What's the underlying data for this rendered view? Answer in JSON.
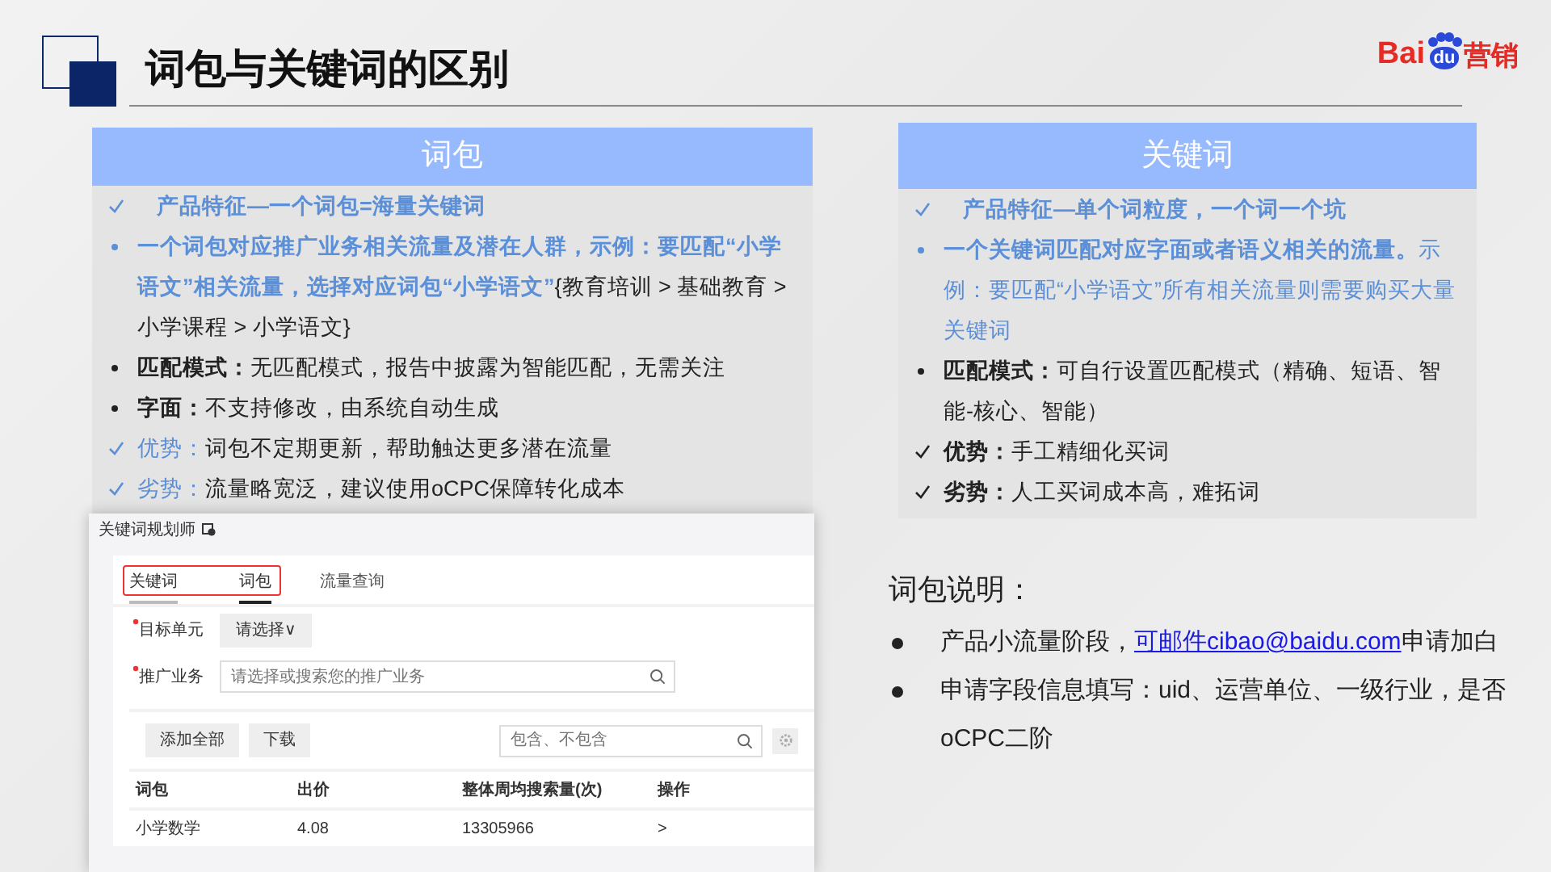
{
  "slide": {
    "title": "词包与关键词的区别"
  },
  "logo": {
    "brand": "Bai",
    "paw_text": "du",
    "suffix": "营销"
  },
  "panels": [
    {
      "header": "词包",
      "items": [
        {
          "kind": "check",
          "accent": true,
          "indent": true,
          "parts": [
            {
              "text": "**产品特征—一个词包=海量关键词**",
              "accent": true
            }
          ]
        },
        {
          "kind": "dot",
          "accent": true,
          "indent": false,
          "parts": [
            {
              "text": "**一个词包对应推广业务相关流量及潜在人群，示例：要匹配“小学语文”相关流量，选择对应词包“小学语文”**",
              "accent": true
            },
            {
              "text": "{教育培训 > 基础教育 > 小学课程 > 小学语文}",
              "accent": false
            }
          ]
        },
        {
          "kind": "dot",
          "accent": false,
          "indent": false,
          "parts": [
            {
              "text": "**匹配模式：**无匹配模式，报告中披露为智能匹配，无需关注",
              "accent": false
            }
          ]
        },
        {
          "kind": "dot",
          "accent": false,
          "indent": false,
          "parts": [
            {
              "text": "**字面：**不支持修改，由系统自动生成",
              "accent": false
            }
          ]
        },
        {
          "kind": "check",
          "accent": true,
          "indent": false,
          "parts": [
            {
              "text": "优势：",
              "accent": true
            },
            {
              "text": "词包不定期更新，帮助触达更多潜在流量",
              "accent": false
            }
          ]
        },
        {
          "kind": "check",
          "accent": true,
          "indent": false,
          "parts": [
            {
              "text": "劣势：",
              "accent": true
            },
            {
              "text": "流量略宽泛，建议使用oCPC保障转化成本",
              "accent": false
            }
          ]
        }
      ]
    },
    {
      "header": "关键词",
      "items": [
        {
          "kind": "check",
          "accent": true,
          "indent": true,
          "parts": [
            {
              "text": "**产品特征—单个词粒度，一个词一个坑**",
              "accent": true
            }
          ]
        },
        {
          "kind": "dot",
          "accent": true,
          "indent": false,
          "parts": [
            {
              "text": "**一个关键词匹配对应字面或者语义相关的流量。**示例：要匹配“小学语文”所有相关流量则需要购买大量关键词",
              "accent": true
            }
          ]
        },
        {
          "kind": "dot",
          "accent": false,
          "indent": false,
          "parts": [
            {
              "text": "**匹配模式：**可自行设置匹配模式（精确、短语、智能-核心、智能）",
              "accent": false
            }
          ]
        },
        {
          "kind": "check",
          "accent": false,
          "indent": false,
          "parts": [
            {
              "text": "**优势：**手工精细化买词",
              "accent": false
            }
          ]
        },
        {
          "kind": "check",
          "accent": false,
          "indent": false,
          "parts": [
            {
              "text": "**劣势：**人工买词成本高，难拓词",
              "accent": false
            }
          ]
        }
      ]
    }
  ],
  "screenshot": {
    "title": "关键词规划师",
    "tabs": [
      {
        "label": "关键词",
        "selected": false
      },
      {
        "label": "词包",
        "selected": true
      },
      {
        "label": "流量查询",
        "selected": false
      }
    ],
    "fields": [
      {
        "label": "目标单元",
        "required": true,
        "kind": "select",
        "value": "请选择∨"
      },
      {
        "label": "推广业务",
        "required": true,
        "kind": "search",
        "placeholder": "请选择或搜索您的推广业务"
      }
    ],
    "buttons": [
      "添加全部",
      "下载"
    ],
    "filter": {
      "placeholder": "包含、不包含"
    },
    "table": {
      "columns": [
        "词包",
        "出价",
        "整体周均搜索量(次)",
        "操作"
      ],
      "rows": [
        [
          "小学数学",
          "4.08",
          "13305966",
          ">"
        ]
      ]
    }
  },
  "notes": {
    "title": "词包说明：",
    "items": [
      {
        "parts": [
          {
            "text": "产品小流量阶段，",
            "link": false
          },
          {
            "text": "可邮件cibao@baidu.com",
            "link": true
          },
          {
            "text": "申请加白",
            "link": false
          }
        ]
      },
      {
        "parts": [
          {
            "text": "申请字段信息填写：uid、运营单位、一级行业，是否oCPC二阶",
            "link": false
          }
        ]
      }
    ]
  }
}
